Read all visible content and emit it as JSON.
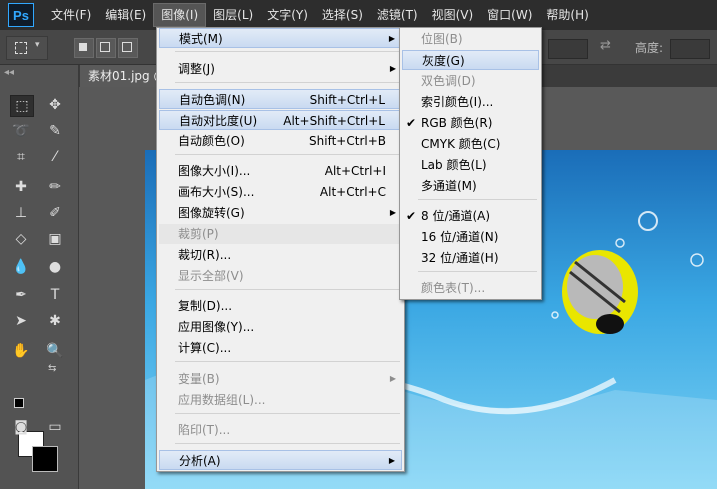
{
  "app": {
    "logo": "Ps"
  },
  "menubar": {
    "items": [
      "文件(F)",
      "编辑(E)",
      "图像(I)",
      "图层(L)",
      "文字(Y)",
      "选择(S)",
      "滤镜(T)",
      "视图(V)",
      "窗口(W)",
      "帮助(H)"
    ],
    "active": "图像(I)"
  },
  "options_bar": {
    "height_label": "高度:"
  },
  "document": {
    "tab_title": "素材01.jpg @"
  },
  "image_menu": {
    "mode": {
      "label": "模式(M)"
    },
    "adjust": {
      "label": "调整(J)"
    },
    "auto_tone": {
      "label": "自动色调(N)",
      "shortcut": "Shift+Ctrl+L"
    },
    "auto_contrast": {
      "label": "自动对比度(U)",
      "shortcut": "Alt+Shift+Ctrl+L"
    },
    "auto_color": {
      "label": "自动颜色(O)",
      "shortcut": "Shift+Ctrl+B"
    },
    "image_size": {
      "label": "图像大小(I)...",
      "shortcut": "Alt+Ctrl+I"
    },
    "canvas_size": {
      "label": "画布大小(S)...",
      "shortcut": "Alt+Ctrl+C"
    },
    "rotation": {
      "label": "图像旋转(G)"
    },
    "crop": {
      "label": "裁剪(P)"
    },
    "trim": {
      "label": "裁切(R)..."
    },
    "reveal_all": {
      "label": "显示全部(V)"
    },
    "duplicate": {
      "label": "复制(D)..."
    },
    "apply_image": {
      "label": "应用图像(Y)..."
    },
    "calculations": {
      "label": "计算(C)..."
    },
    "variables": {
      "label": "变量(B)"
    },
    "apply_dataset": {
      "label": "应用数据组(L)..."
    },
    "trap": {
      "label": "陷印(T)..."
    },
    "analysis": {
      "label": "分析(A)"
    }
  },
  "mode_submenu": {
    "bitmap": "位图(B)",
    "grayscale": "灰度(G)",
    "duotone": "双色调(D)",
    "indexed": "索引颜色(I)...",
    "rgb": "RGB 颜色(R)",
    "cmyk": "CMYK 颜色(C)",
    "lab": "Lab 颜色(L)",
    "multichannel": "多通道(M)",
    "bit8": "8 位/通道(A)",
    "bit16": "16 位/通道(N)",
    "bit32": "32 位/通道(H)",
    "color_table": "颜色表(T)...",
    "checkmark": "✔",
    "highlighted": "灰度(G)"
  },
  "colors": {
    "menubar_bg": "#2d2d2d",
    "menu_bg": "#f0f0f0",
    "highlight": "#c9daf1",
    "disabled_text": "#8d8d8d"
  }
}
